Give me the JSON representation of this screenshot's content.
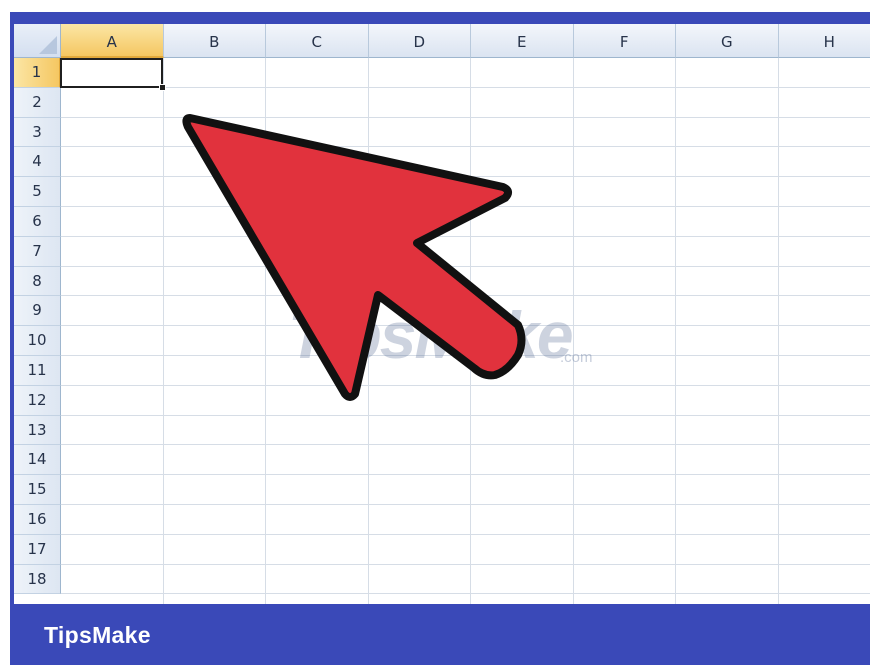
{
  "sheet": {
    "columns": [
      "A",
      "B",
      "C",
      "D",
      "E",
      "F",
      "G",
      "H"
    ],
    "rows": [
      "1",
      "2",
      "3",
      "4",
      "5",
      "6",
      "7",
      "8",
      "9",
      "10",
      "11",
      "12",
      "13",
      "14",
      "15",
      "16",
      "17",
      "18"
    ],
    "active_column": "A",
    "active_row": "1",
    "active_cell_value": ""
  },
  "watermark": {
    "text": "TipsMake",
    "suffix": ".com"
  },
  "footer": {
    "brand": "TipsMake"
  },
  "colors": {
    "frame_blue": "#3a49b8",
    "arrow_red": "#e1323d",
    "active_header": "#f5c762"
  },
  "annotation": {
    "icon": "red-pointer-arrow-icon"
  }
}
